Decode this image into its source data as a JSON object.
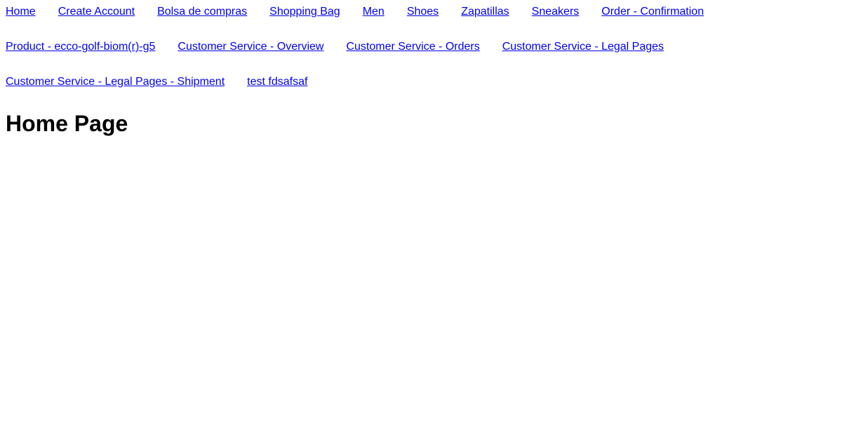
{
  "nav": {
    "links": [
      "Home",
      "Create Account",
      "Bolsa de compras",
      "Shopping Bag",
      "Men",
      "Shoes",
      "Zapatillas",
      "Sneakers",
      "Order - Confirmation",
      "Product - ecco-golf-biom(r)-g5",
      "Customer Service - Overview",
      "Customer Service - Orders",
      "Customer Service - Legal Pages",
      "Customer Service - Legal Pages - Shipment",
      "test fdsafsaf"
    ]
  },
  "page": {
    "title": "Home Page"
  }
}
